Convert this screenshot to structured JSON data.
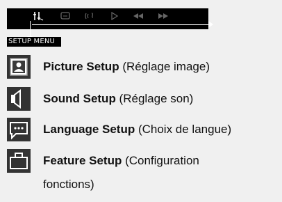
{
  "menu_bar": {
    "icons": [
      {
        "name": "picture-setup-tab-icon",
        "glyph": "⫶↳",
        "active": true
      },
      {
        "name": "language-tab-icon",
        "glyph": "▭"
      },
      {
        "name": "sound-tab-icon",
        "glyph": "((⁠ᶜ"
      },
      {
        "name": "play-tab-icon",
        "glyph": "▷"
      },
      {
        "name": "rewind-tab-icon",
        "glyph": "◀◀"
      },
      {
        "name": "forward-tab-icon",
        "glyph": "▶▶"
      }
    ]
  },
  "section_label": "SETUP MENU",
  "items": [
    {
      "title": "Picture Setup",
      "subtitle": " (Réglage image)",
      "icon": "picture-icon"
    },
    {
      "title": "Sound Setup",
      "subtitle": " (Réglage son)",
      "icon": "speaker-icon"
    },
    {
      "title": "Language Setup",
      "subtitle": " (Choix de langue)",
      "icon": "speech-bubble-icon"
    },
    {
      "title": "Feature Setup",
      "subtitle": " (Configuration",
      "subtitle_line2": "fonctions)",
      "icon": "briefcase-icon"
    }
  ]
}
